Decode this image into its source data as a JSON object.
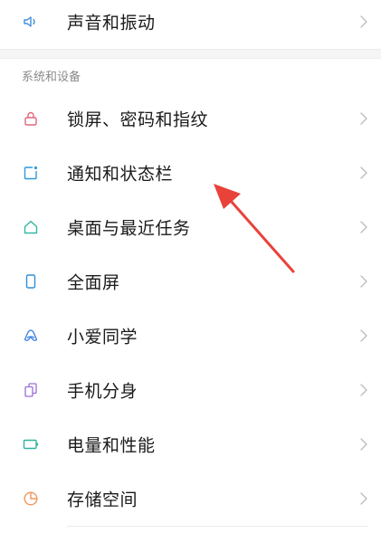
{
  "top_item": {
    "label": "声音和振动",
    "icon": "speaker-icon",
    "color": "#3f8dd6"
  },
  "section": {
    "header": "系统和设备",
    "items": [
      {
        "label": "锁屏、密码和指纹",
        "icon": "lock-icon",
        "color": "#e2667a"
      },
      {
        "label": "通知和状态栏",
        "icon": "notification-icon",
        "color": "#2e9ad9"
      },
      {
        "label": "桌面与最近任务",
        "icon": "home-icon",
        "color": "#35b8a3"
      },
      {
        "label": "全面屏",
        "icon": "phone-screen-icon",
        "color": "#2e8fd9"
      },
      {
        "label": "小爱同学",
        "icon": "xiaoai-icon",
        "color": "#3b7fe0"
      },
      {
        "label": "手机分身",
        "icon": "dual-phone-icon",
        "color": "#9a6fd6"
      },
      {
        "label": "电量和性能",
        "icon": "battery-icon",
        "color": "#2fb39a"
      },
      {
        "label": "存储空间",
        "icon": "storage-pie-icon",
        "color": "#f0955a"
      }
    ]
  },
  "annotation": {
    "type": "red-arrow",
    "color": "#e8423a"
  }
}
